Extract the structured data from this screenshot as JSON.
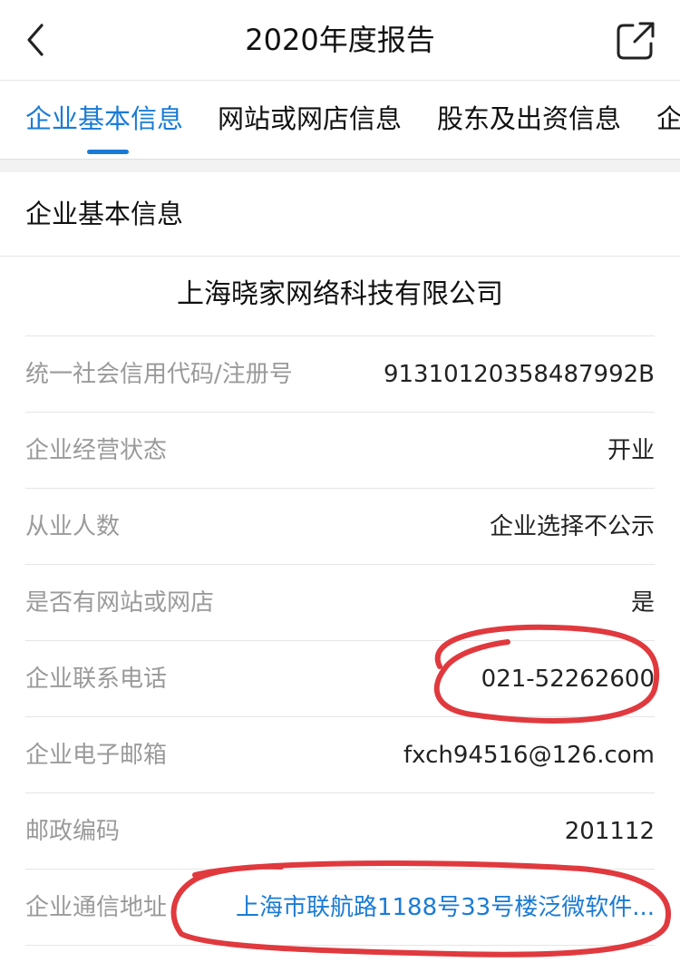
{
  "header": {
    "title": "2020年度报告",
    "back_icon": "chevron-left-icon",
    "share_icon": "share-icon"
  },
  "tabs": [
    {
      "label": "企业基本信息",
      "active": true
    },
    {
      "label": "网站或网店信息",
      "active": false
    },
    {
      "label": "股东及出资信息",
      "active": false
    },
    {
      "label": "企",
      "active": false
    }
  ],
  "section": {
    "title": "企业基本信息",
    "company_name": "上海晓家网络科技有限公司"
  },
  "rows": [
    {
      "label": "统一社会信用代码/注册号",
      "value": "91310120358487992B"
    },
    {
      "label": "企业经营状态",
      "value": "开业"
    },
    {
      "label": "从业人数",
      "value": "企业选择不公示"
    },
    {
      "label": "是否有网站或网店",
      "value": "是"
    },
    {
      "label": "企业联系电话",
      "value": "021-52262600"
    },
    {
      "label": "企业电子邮箱",
      "value": "fxch94516@126.com"
    },
    {
      "label": "邮政编码",
      "value": "201112"
    },
    {
      "label": "企业通信地址",
      "value": "上海市联航路1188号33号楼泛微软件..."
    }
  ],
  "colors": {
    "accent": "#1a7bd6",
    "annotation": "#e0393e"
  }
}
